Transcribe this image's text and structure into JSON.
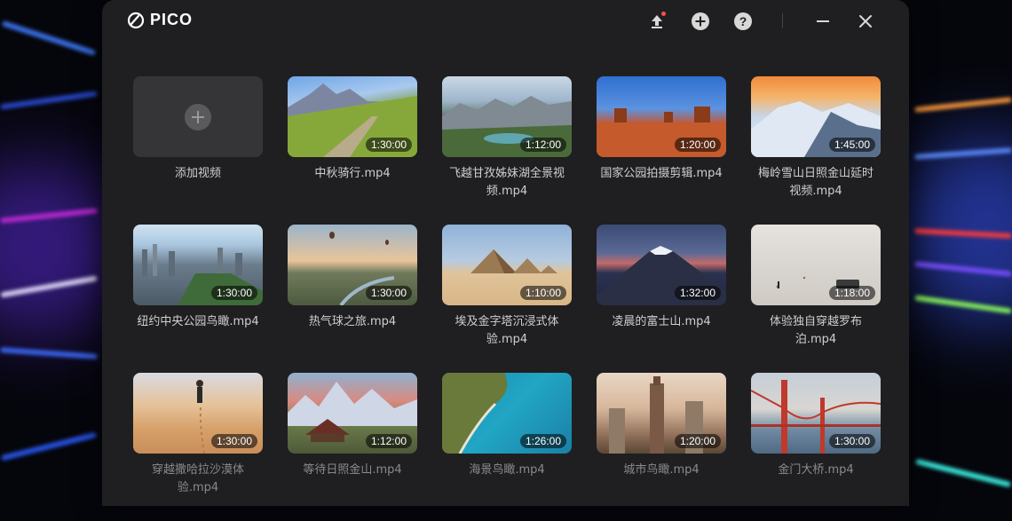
{
  "app": {
    "title": "PICO"
  },
  "toolbar": {
    "upload_icon": "upload-icon",
    "add_icon": "add-circle-icon",
    "help_icon": "help-icon",
    "minimize_icon": "minimize-icon",
    "close_icon": "close-icon"
  },
  "add_card": {
    "label": "添加视频"
  },
  "videos": [
    {
      "name": "中秋骑行.mp4",
      "duration": "1:30:00"
    },
    {
      "name": "飞越甘孜姊妹湖全景视频.mp4",
      "duration": "1:12:00"
    },
    {
      "name": "国家公园拍摄剪辑.mp4",
      "duration": "1:20:00"
    },
    {
      "name": "梅岭雪山日照金山延时视频.mp4",
      "duration": "1:45:00"
    },
    {
      "name": "纽约中央公园鸟瞰.mp4",
      "duration": "1:30:00"
    },
    {
      "name": "热气球之旅.mp4",
      "duration": "1:30:00"
    },
    {
      "name": "埃及金字塔沉浸式体验.mp4",
      "duration": "1:10:00"
    },
    {
      "name": "凌晨的富士山.mp4",
      "duration": "1:32:00"
    },
    {
      "name": "体验独自穿越罗布泊.mp4",
      "duration": "1:18:00"
    },
    {
      "name": "穿越撒哈拉沙漠体验.mp4",
      "duration": "1:30:00"
    },
    {
      "name": "等待日照金山.mp4",
      "duration": "1:12:00"
    },
    {
      "name": "海景鸟瞰.mp4",
      "duration": "1:26:00"
    },
    {
      "name": "城市鸟瞰.mp4",
      "duration": "1:20:00"
    },
    {
      "name": "金门大桥.mp4",
      "duration": "1:30:00"
    }
  ]
}
